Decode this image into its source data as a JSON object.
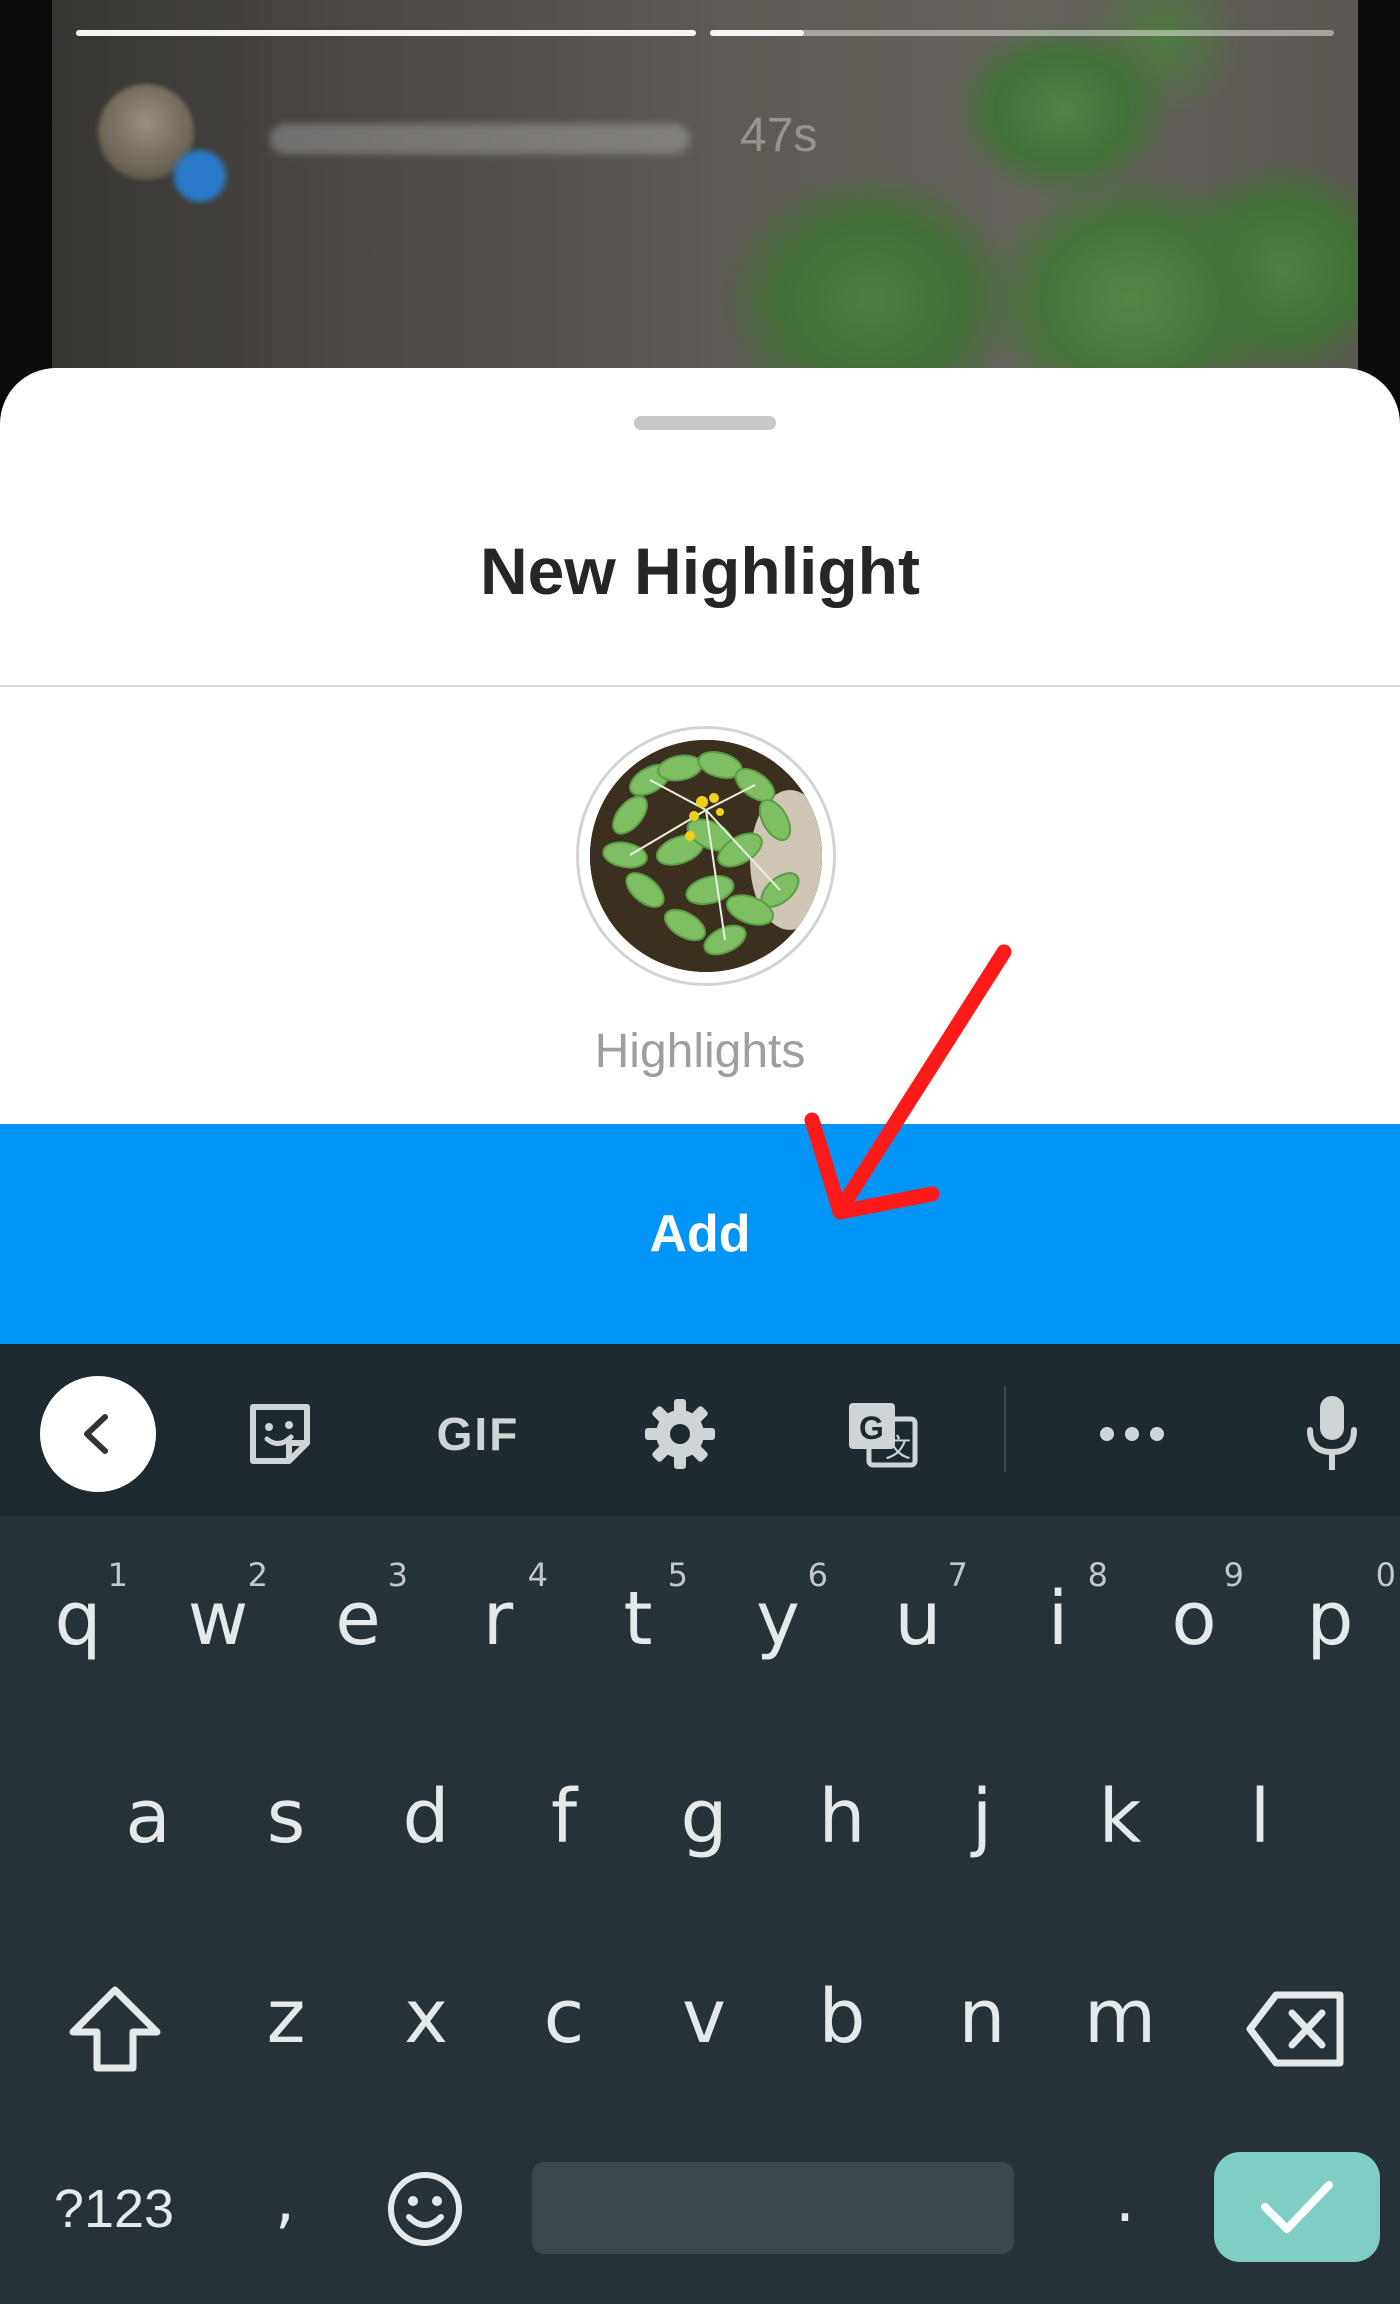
{
  "story": {
    "time": "47s",
    "progress": [
      1.0,
      0.15
    ]
  },
  "sheet": {
    "title": "New Highlight",
    "cover_label": "Highlights"
  },
  "actions": {
    "add_label": "Add"
  },
  "keyboard": {
    "toolbar": {
      "gif_label": "GIF",
      "icons": [
        "back-icon",
        "sticker-icon",
        "gif-icon",
        "settings-icon",
        "translate-icon",
        "more-icon",
        "microphone-icon"
      ]
    },
    "row1": [
      {
        "k": "q",
        "n": "1"
      },
      {
        "k": "w",
        "n": "2"
      },
      {
        "k": "e",
        "n": "3"
      },
      {
        "k": "r",
        "n": "4"
      },
      {
        "k": "t",
        "n": "5"
      },
      {
        "k": "y",
        "n": "6"
      },
      {
        "k": "u",
        "n": "7"
      },
      {
        "k": "i",
        "n": "8"
      },
      {
        "k": "o",
        "n": "9"
      },
      {
        "k": "p",
        "n": "0"
      }
    ],
    "row2": [
      "a",
      "s",
      "d",
      "f",
      "g",
      "h",
      "j",
      "k",
      "l"
    ],
    "row3": [
      "z",
      "x",
      "c",
      "v",
      "b",
      "n",
      "m"
    ],
    "symbols_label": "?123",
    "comma": ",",
    "period": ".",
    "accent_color": "#7fcdc3"
  },
  "colors": {
    "add_button": "#0095f6",
    "annotation_arrow": "#ff1a1a",
    "keyboard_bg": "#263238"
  }
}
